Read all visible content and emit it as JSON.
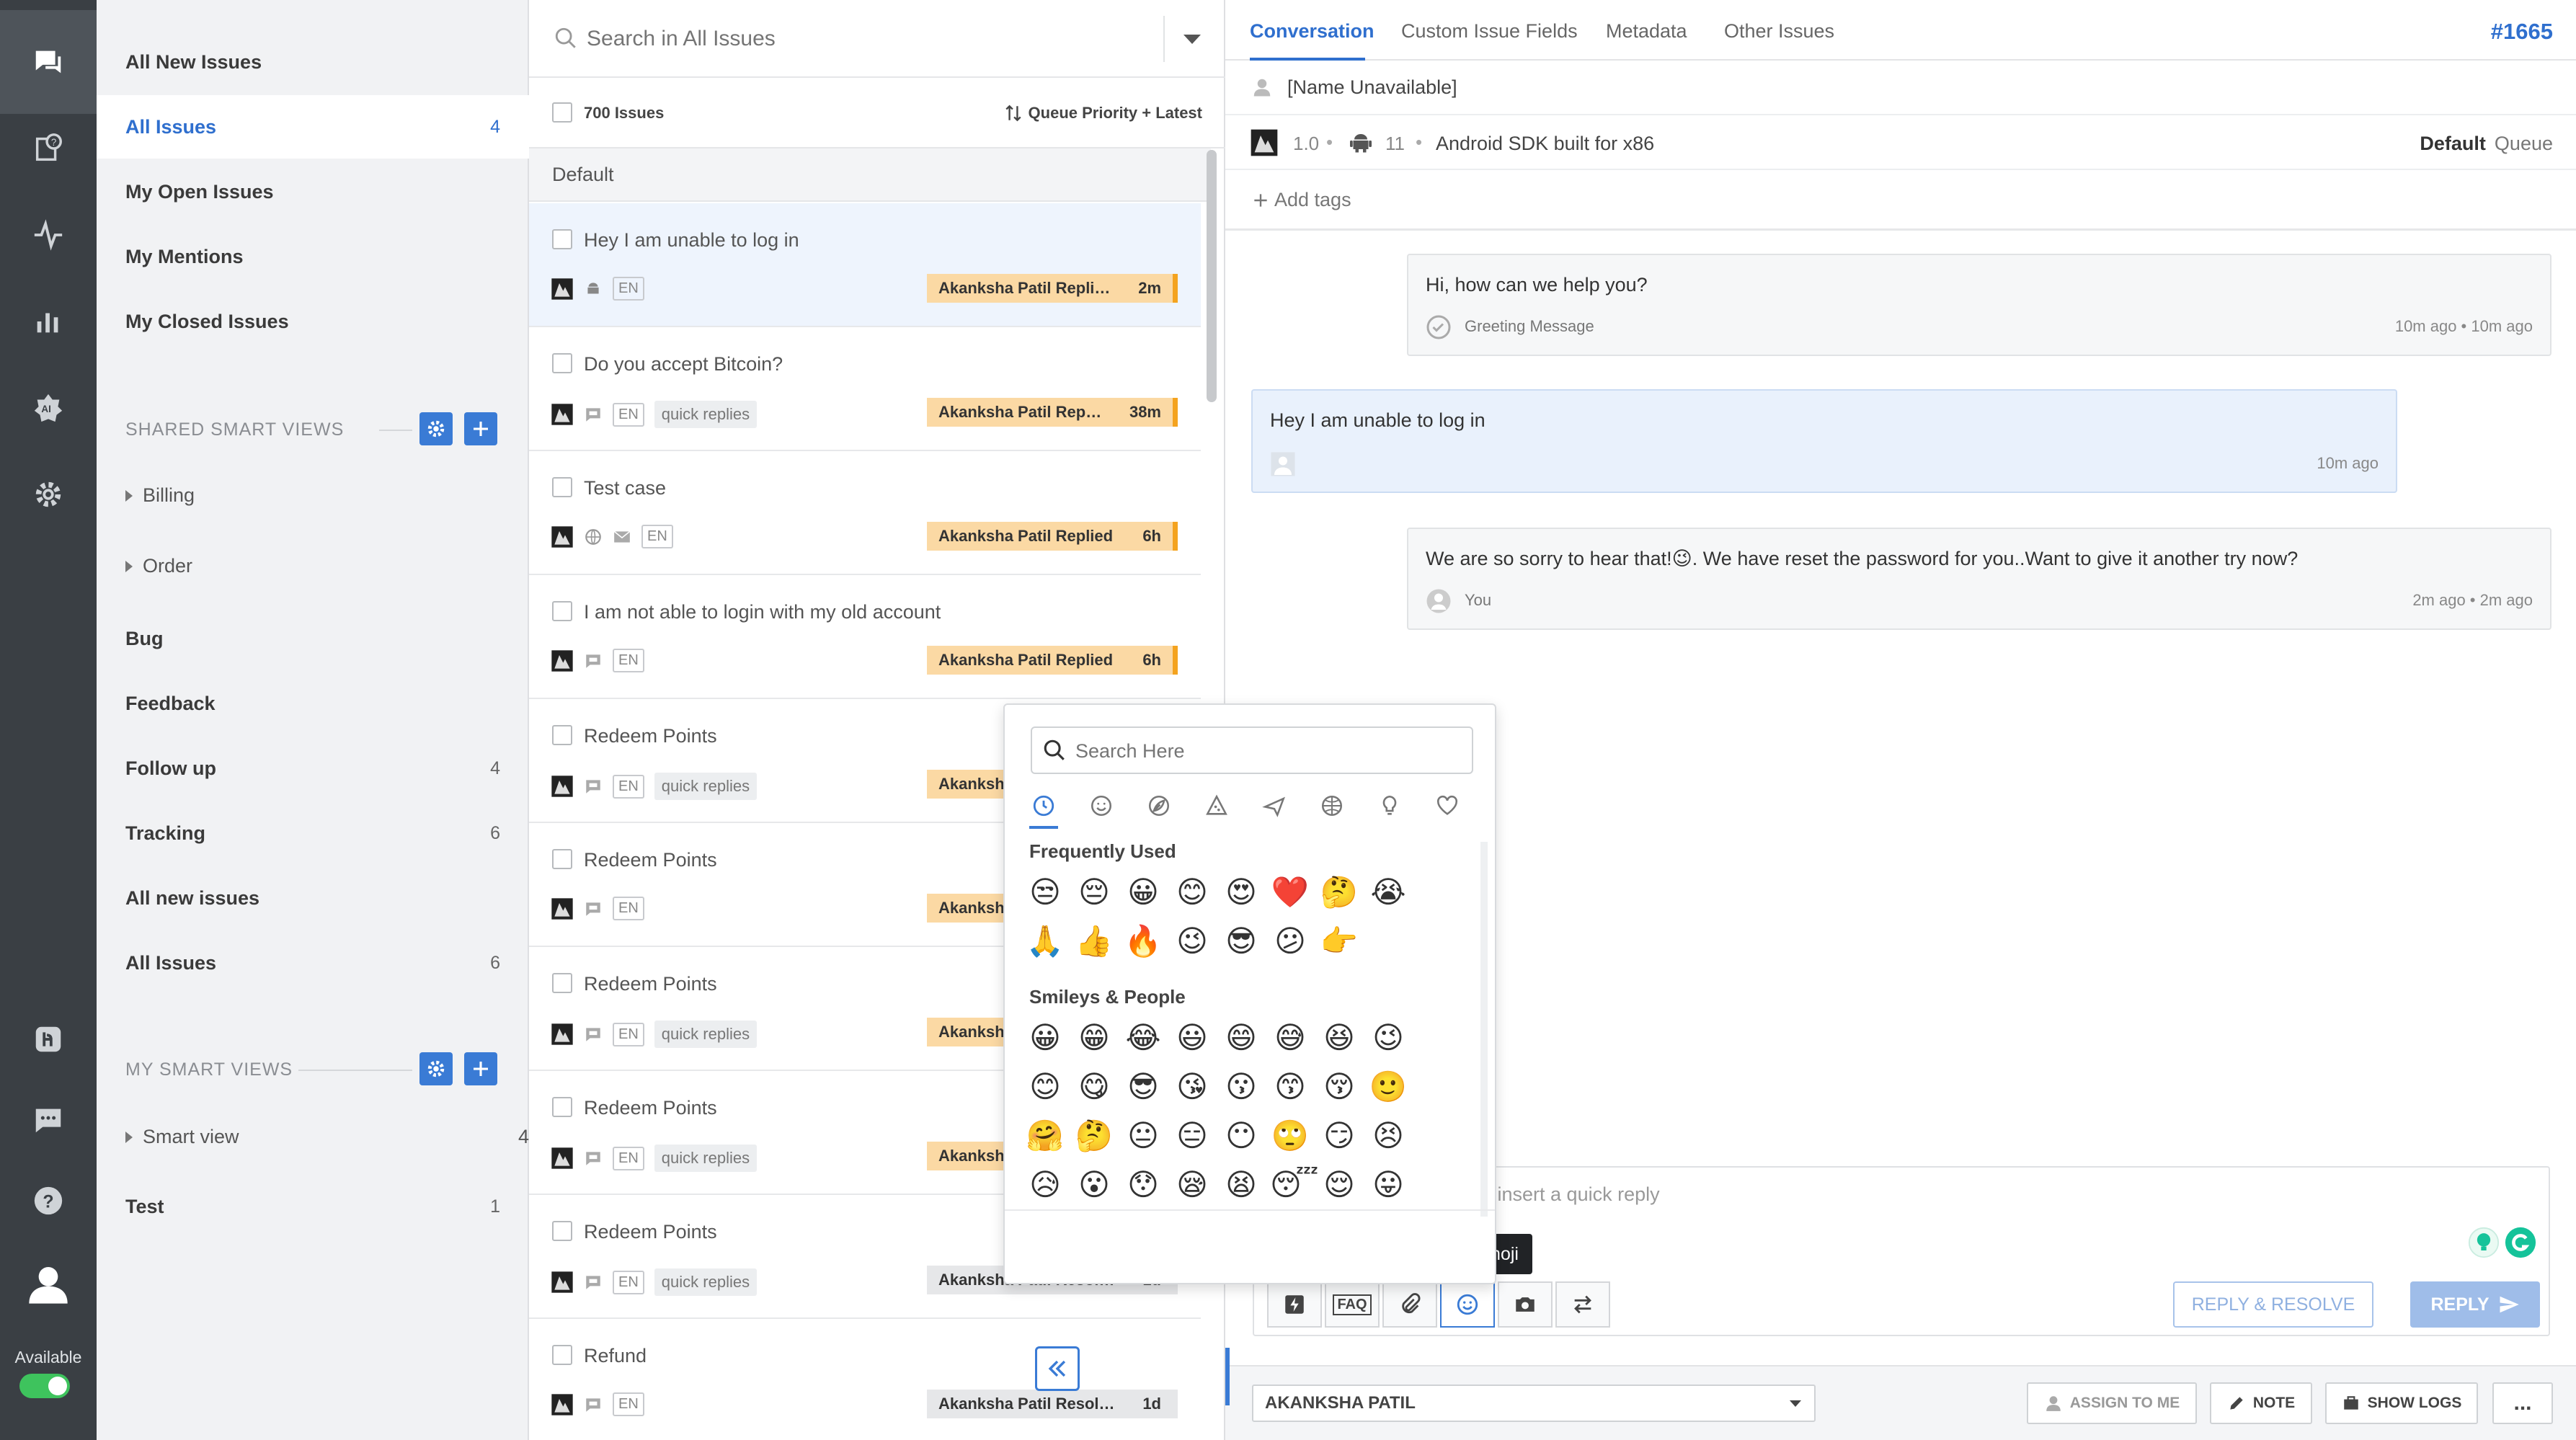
{
  "sidebar": {
    "availability": "Available",
    "views": [
      {
        "label": "All New Issues",
        "count": ""
      },
      {
        "label": "All Issues",
        "count": "4"
      },
      {
        "label": "My Open Issues",
        "count": ""
      },
      {
        "label": "My Mentions",
        "count": ""
      },
      {
        "label": "My Closed Issues",
        "count": ""
      }
    ],
    "shared_heading": "SHARED SMART VIEWS",
    "shared_views": [
      {
        "label": "Billing",
        "count": ""
      },
      {
        "label": "Order",
        "count": ""
      },
      {
        "label": "Bug",
        "count": ""
      },
      {
        "label": "Feedback",
        "count": ""
      },
      {
        "label": "Follow up",
        "count": "4"
      },
      {
        "label": "Tracking",
        "count": "6"
      },
      {
        "label": "All new issues",
        "count": ""
      },
      {
        "label": "All Issues",
        "count": "6"
      }
    ],
    "my_heading": "MY SMART VIEWS",
    "my_views": [
      {
        "label": "Smart view",
        "count": "4"
      },
      {
        "label": "Test",
        "count": "1"
      }
    ]
  },
  "issue_list": {
    "search_placeholder": "Search in All Issues",
    "total": "700 Issues",
    "sort": "Queue Priority + Latest",
    "group": "Default",
    "rows": [
      {
        "title": "Hey I am unable to log in",
        "lang": "EN",
        "tag": "",
        "status": "Akanksha Patil Repli…",
        "time": "2m"
      },
      {
        "title": "Do you accept Bitcoin?",
        "lang": "EN",
        "tag": "quick replies",
        "status": "Akanksha Patil Rep…",
        "time": "38m"
      },
      {
        "title": "Test case",
        "lang": "EN",
        "tag": "",
        "status": "Akanksha Patil Replied",
        "time": "6h"
      },
      {
        "title": "I am not able to login with my old account",
        "lang": "EN",
        "tag": "",
        "status": "Akanksha Patil Replied",
        "time": "6h"
      },
      {
        "title": "Redeem Points",
        "lang": "EN",
        "tag": "quick replies",
        "status": "Akanksh",
        "time": ""
      },
      {
        "title": "Redeem Points",
        "lang": "EN",
        "tag": "",
        "status": "Akanksh",
        "time": ""
      },
      {
        "title": "Redeem Points",
        "lang": "EN",
        "tag": "quick replies",
        "status": "Akanksh",
        "time": ""
      },
      {
        "title": "Redeem Points",
        "lang": "EN",
        "tag": "quick replies",
        "status": "Akanksh",
        "time": ""
      },
      {
        "title": "Redeem Points",
        "lang": "EN",
        "tag": "quick replies",
        "status": "Akanksha Patil Resol…",
        "time": "1d"
      },
      {
        "title": "Refund",
        "lang": "EN",
        "tag": "",
        "status": "Akanksha Patil Resol…",
        "time": "1d"
      }
    ]
  },
  "conversation": {
    "tabs": [
      "Conversation",
      "Custom Issue Fields",
      "Metadata",
      "Other Issues"
    ],
    "issue_id": "#1665",
    "customer_name": "[Name Unavailable]",
    "app_version": "1.0",
    "os_version": "11",
    "device": "Android SDK built for x86",
    "queue_name": "Default",
    "queue_label": "Queue",
    "add_tags": "Add tags",
    "messages": [
      {
        "text": "Hi, how can we help you?",
        "sender": "Greeting Message",
        "time": "10m ago • 10m ago"
      },
      {
        "text": "Hey I am unable to log in",
        "sender": "",
        "time": "10m ago"
      },
      {
        "text": "We are so sorry to hear that!😉. We have reset the password for you..Want to give it another try now?",
        "sender": "You",
        "time": "2m ago • 2m ago"
      }
    ],
    "compose_placeholder": "o insert a quick reply",
    "tooltip": "Insert Emoji",
    "faq_label": "FAQ",
    "reply_resolve": "REPLY & RESOLVE",
    "reply": "REPLY",
    "assignee": "AKANKSHA PATIL",
    "assign_to_me": "ASSIGN TO ME",
    "note": "NOTE",
    "show_logs": "SHOW LOGS",
    "more": "..."
  },
  "emoji_picker": {
    "search_placeholder": "Search Here",
    "frequent_heading": "Frequently Used",
    "frequent": [
      "😒",
      "😔",
      "😀",
      "😊",
      "😍",
      "❤️",
      "🤔",
      "😭",
      "🙏",
      "👍",
      "🔥",
      "😉",
      "😎",
      "😕",
      "👉"
    ],
    "smileys_heading": "Smileys & People",
    "smileys": [
      "😀",
      "😁",
      "😂",
      "😃",
      "😄",
      "😅",
      "😆",
      "😉",
      "😊",
      "😋",
      "😎",
      "😘",
      "😗",
      "😙",
      "😚",
      "🙂",
      "🤗",
      "🤔",
      "😐",
      "😑",
      "😶",
      "🙄",
      "😏",
      "😣",
      "😥",
      "😮",
      "😯",
      "😪",
      "😫",
      "😴",
      "😌",
      "😛"
    ]
  },
  "colors": {
    "accent": "#2f6fce",
    "status_orange": "#f4a31f",
    "available_green": "#3ec35d"
  }
}
